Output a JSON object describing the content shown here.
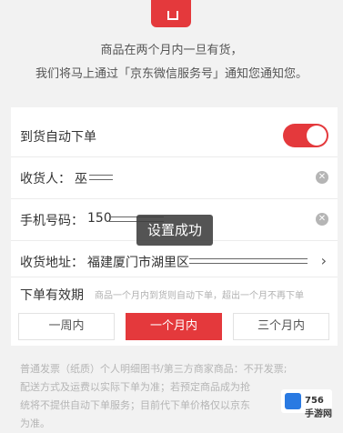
{
  "notice": {
    "line1": "商品在两个月内一旦有货，",
    "line2": "我们将马上通过「京东微信服务号」通知您通知您。"
  },
  "auto_order": {
    "label": "到货自动下单",
    "enabled": true
  },
  "receiver": {
    "label": "收货人：",
    "value": "巫"
  },
  "phone": {
    "label": "手机号码：",
    "value": "150"
  },
  "address": {
    "label": "收货地址：",
    "value": "福建厦门市湖里区"
  },
  "toast": {
    "text": "设置成功"
  },
  "validity": {
    "label": "下单有效期",
    "hint": "商品一个月内到货则自动下单，超出一个月不再下单",
    "options": [
      "一周内",
      "一个月内",
      "三个月内"
    ],
    "selected": "一个月内"
  },
  "footer": {
    "line1": "普通发票（纸质）个人明细图书/第三方商家商品：不开发票;",
    "line2": "配送方式及运费以实际下单为准；若预定商品成为抢",
    "line3": "统将不提供自动下单服务；目前代下单价格仅以京东",
    "line4": "为准。"
  },
  "watermark": {
    "text": "756手游网"
  },
  "colors": {
    "accent": "#e4393c"
  }
}
